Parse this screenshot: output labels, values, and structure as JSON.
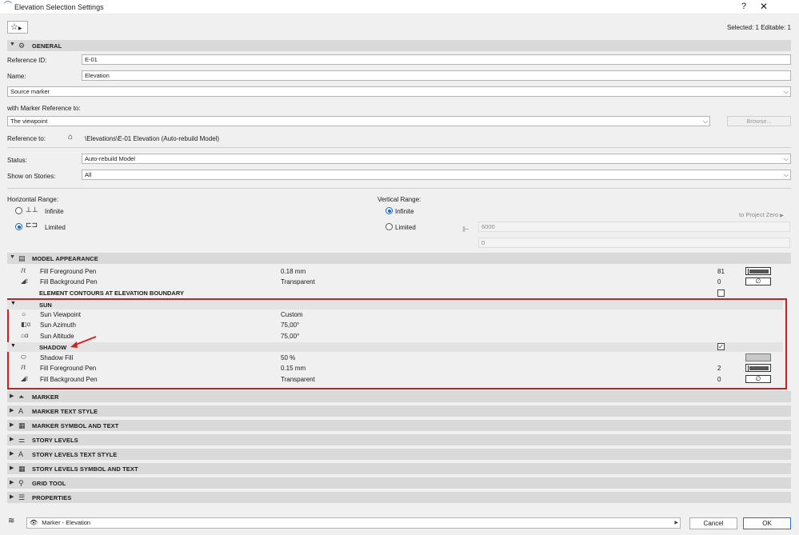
{
  "window": {
    "title": "Elevation Selection Settings",
    "help": "?",
    "close": "✕",
    "selection_info": "Selected: 1 Editable: 1"
  },
  "general": {
    "header": "GENERAL",
    "reference_id_label": "Reference ID:",
    "reference_id_value": "E-01",
    "name_label": "Name:",
    "name_value": "Elevation",
    "source_marker": "Source marker",
    "marker_reference_label": "with Marker Reference to:",
    "marker_reference_value": "The viewpoint",
    "browse_label": "Browse...",
    "reference_to_label": "Reference to:",
    "reference_to_value": "\\Elevations\\E-01 Elevation (Auto-rebuild Model)",
    "status_label": "Status:",
    "status_value": "Auto-rebuild Model",
    "show_on_stories_label": "Show on Stories:",
    "show_on_stories_value": "All",
    "horizontal_range_label": "Horizontal Range:",
    "horizontal_infinite": "Infinite",
    "horizontal_limited": "Limited",
    "horizontal_selected": "Limited",
    "vertical_range_label": "Vertical Range:",
    "vertical_infinite": "Infinite",
    "vertical_limited": "Limited",
    "vertical_selected": "Infinite",
    "to_project_zero": "to Project Zero",
    "vertical_top": "6000",
    "vertical_bottom": "0"
  },
  "model_appearance": {
    "header": "MODEL APPEARANCE",
    "rows": [
      {
        "name": "Fill Foreground Pen",
        "value": "0.18 mm",
        "num": "81"
      },
      {
        "name": "Fill Background Pen",
        "value": "Transparent",
        "num": "0"
      }
    ],
    "contours_label": "ELEMENT CONTOURS AT ELEVATION BOUNDARY",
    "contours_checked": false
  },
  "sun": {
    "header": "SUN",
    "rows": [
      {
        "name": "Sun Viewpoint",
        "value": "Custom"
      },
      {
        "name": "Sun Azimuth",
        "value": "75,00°"
      },
      {
        "name": "Sun Altitude",
        "value": "75,00°"
      }
    ]
  },
  "shadow": {
    "header": "SHADOW",
    "checked": true,
    "rows": [
      {
        "name": "Shadow Fill",
        "value": "50 %",
        "num": ""
      },
      {
        "name": "Fill Foreground Pen",
        "value": "0.15 mm",
        "num": "2"
      },
      {
        "name": "Fill Background Pen",
        "value": "Transparent",
        "num": "0"
      }
    ]
  },
  "collapsed_sections": [
    "MARKER",
    "MARKER TEXT STYLE",
    "MARKER SYMBOL AND TEXT",
    "STORY LEVELS",
    "STORY LEVELS TEXT STYLE",
    "STORY LEVELS SYMBOL AND TEXT",
    "GRID TOOL",
    "PROPERTIES"
  ],
  "footer": {
    "layer_value": "Marker - Elevation",
    "cancel_label": "Cancel",
    "ok_label": "OK"
  },
  "colors": {
    "highlight_box": "#cc1f1f",
    "radio_selected": "#1565c0",
    "section_bar": "#d9d9d9"
  }
}
